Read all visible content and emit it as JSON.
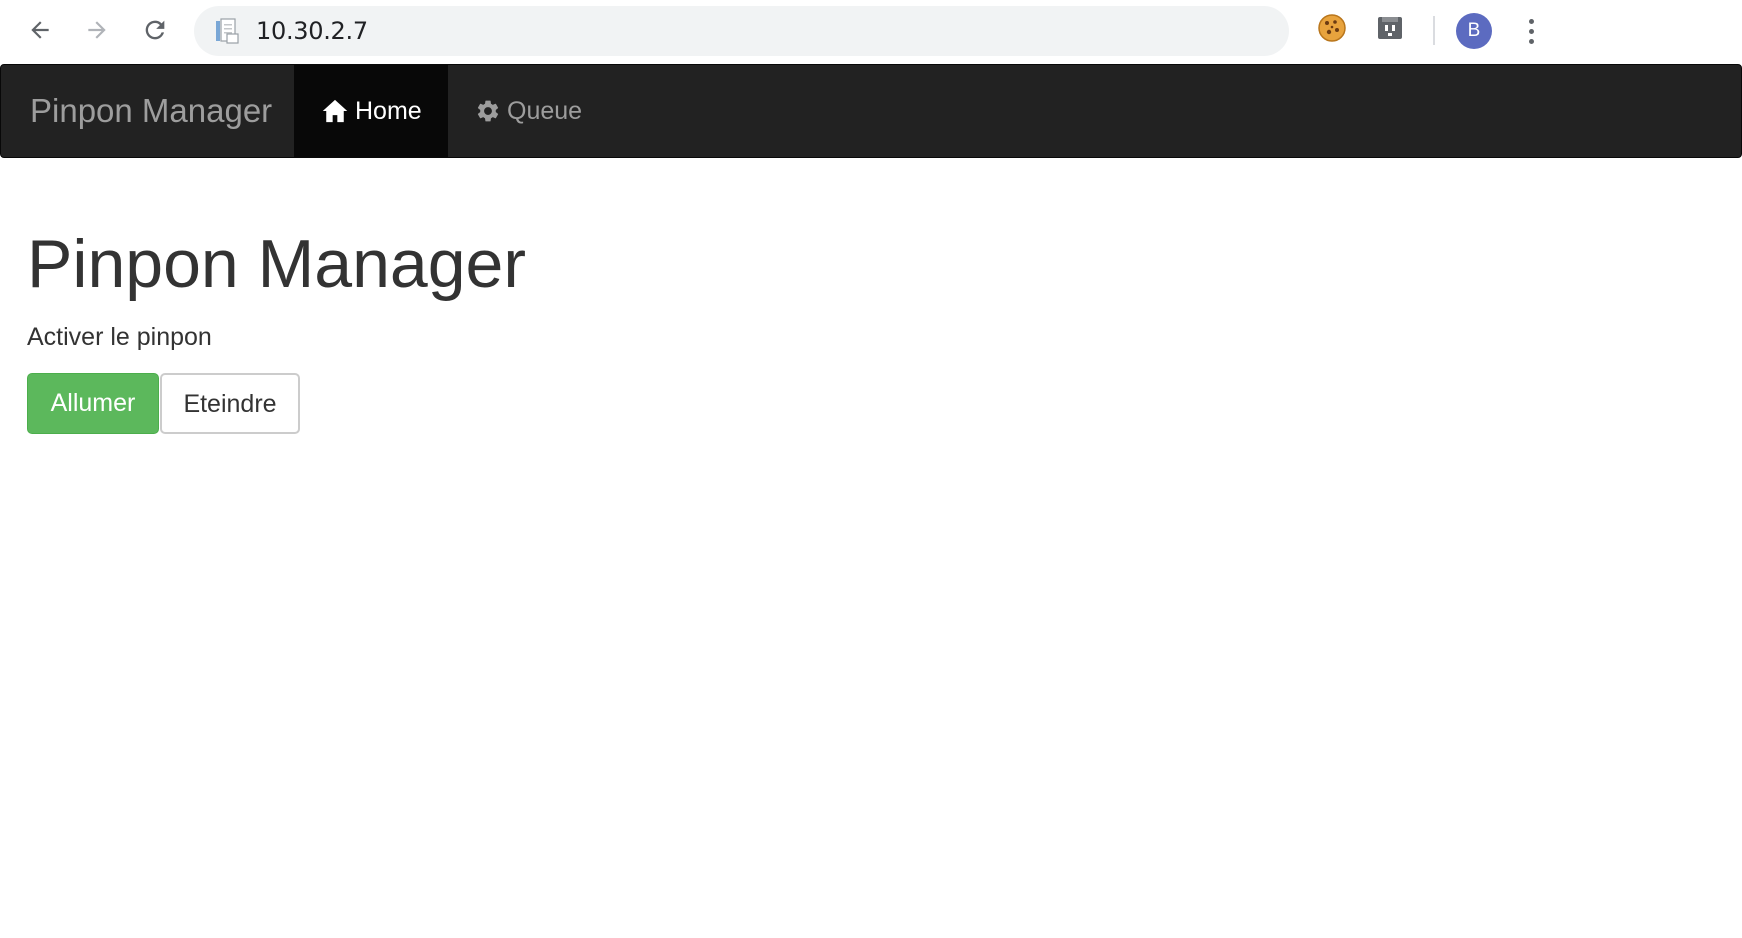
{
  "browser": {
    "url": "10.30.2.7",
    "profile_initial": "B",
    "icons": {
      "back": "arrow-left-icon",
      "forward": "arrow-right-icon",
      "reload": "reload-icon",
      "page": "page-document-icon",
      "extension_1": "cookie-icon",
      "extension_2": "extension-icon",
      "menu": "more-vert-icon"
    },
    "colors": {
      "omnibox_bg": "#f1f3f4",
      "avatar_bg": "#5c6bc0"
    }
  },
  "navbar": {
    "brand": "Pinpon Manager",
    "items": [
      {
        "label": "Home",
        "icon": "home-icon",
        "active": true
      },
      {
        "label": "Queue",
        "icon": "gear-icon",
        "active": false
      }
    ],
    "colors": {
      "background": "#222222",
      "active_bg": "#080808",
      "text": "#9d9d9d",
      "active_text": "#ffffff"
    }
  },
  "main": {
    "title": "Pinpon Manager",
    "subtitle": "Activer le pinpon",
    "buttons": {
      "on_label": "Allumer",
      "off_label": "Eteindre",
      "on_color": "#5cb85c"
    }
  }
}
